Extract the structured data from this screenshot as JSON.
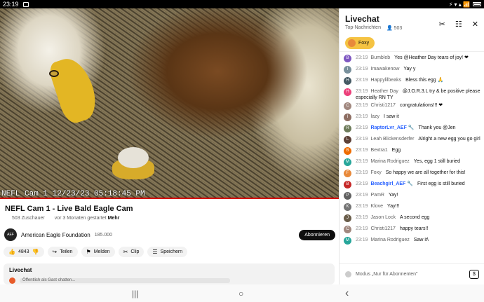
{
  "status": {
    "time": "23:19",
    "right": "⚡ ▾ ▴ 📶"
  },
  "video": {
    "overlay": "NEFL Cam 1 12/23/23 05:18:45 PM",
    "title": "NEFL Cam 1 - Live Bald Eagle Cam",
    "viewers": "503 Zuschauer",
    "started": "vor 3 Monaten gestartet",
    "more": "Mehr"
  },
  "channel": {
    "avatar_text": "AEF",
    "name": "American Eagle Foundation",
    "subs": "185.000",
    "subscribe": "Abonnieren"
  },
  "actions": {
    "likes": "4843",
    "share": "Teilen",
    "report": "Melden",
    "clip": "Clip",
    "save": "Speichern"
  },
  "livechat_box": {
    "title": "Livechat",
    "placeholder": "Öffentlich als Gast chatten..."
  },
  "chat": {
    "title": "Livechat",
    "mode": "Top-Nachrichten",
    "viewers": "503",
    "pinned": "Foxy",
    "input_placeholder": "Modus „Nur für Abonnenten\"",
    "dollar": "$",
    "messages": [
      {
        "time": "23:19",
        "user": "Bumbleb",
        "mod": false,
        "text": "Yes @Heather Day tears of joy! ❤",
        "color": "#7e57c2",
        "initial": "B"
      },
      {
        "time": "23:19",
        "user": "Imawakenow",
        "mod": false,
        "text": "Yay y",
        "color": "#78909c",
        "initial": "I"
      },
      {
        "time": "23:19",
        "user": "Happylilbeaks",
        "mod": false,
        "text": "Bless this egg 🙏",
        "color": "#455a64",
        "initial": "H"
      },
      {
        "time": "23:19",
        "user": "Heather Day",
        "mod": false,
        "text": "@J.O.R.3.L try & be positive please especially RN TY",
        "color": "#ec407a",
        "initial": "H"
      },
      {
        "time": "23:19",
        "user": "Christi1217",
        "mod": false,
        "text": "congratulations!!! ❤",
        "color": "#a1887f",
        "initial": "C"
      },
      {
        "time": "23:19",
        "user": "lazy",
        "mod": false,
        "text": "I saw it",
        "color": "#8d6e63",
        "initial": "l"
      },
      {
        "time": "23:19",
        "user": "RaptorLvr_AEF 🔧",
        "mod": true,
        "text": "Thank you @Jen",
        "color": "#6d7b5a",
        "initial": "R"
      },
      {
        "time": "23:19",
        "user": "Leah Blickensderfer",
        "mod": false,
        "text": "Alright a new egg you go girl",
        "color": "#5d4037",
        "initial": "L"
      },
      {
        "time": "23:19",
        "user": "Bextra1",
        "mod": false,
        "text": "Egg",
        "color": "#ef6c00",
        "initial": "B"
      },
      {
        "time": "23:19",
        "user": "Marina Rodriguez",
        "mod": false,
        "text": "Yes, egg 1 still buried",
        "color": "#26a69a",
        "initial": "M"
      },
      {
        "time": "23:19",
        "user": "Foxy",
        "mod": false,
        "text": "So happy we are all together for this!",
        "color": "#e8893a",
        "initial": "F"
      },
      {
        "time": "23:19",
        "user": "Beachgirl_AEF 🔧",
        "mod": true,
        "text": "First egg is still buried",
        "color": "#c62828",
        "initial": "B"
      },
      {
        "time": "23:19",
        "user": "PamR",
        "mod": false,
        "text": "Yay!",
        "color": "#616161",
        "initial": "P"
      },
      {
        "time": "23:19",
        "user": "Klove",
        "mod": false,
        "text": "Yay!!!",
        "color": "#757575",
        "initial": "K"
      },
      {
        "time": "23:19",
        "user": "Jason Lock",
        "mod": false,
        "text": "A second egg",
        "color": "#6a5d4a",
        "initial": "J"
      },
      {
        "time": "23:19",
        "user": "Christi1217",
        "mod": false,
        "text": "happy tears!!",
        "color": "#a1887f",
        "initial": "C"
      },
      {
        "time": "23:19",
        "user": "Marina Rodriguez",
        "mod": false,
        "text": "Saw it\\",
        "color": "#26a69a",
        "initial": "M"
      }
    ]
  },
  "nav": {
    "recent": "|||",
    "home": "○",
    "back": "‹"
  }
}
